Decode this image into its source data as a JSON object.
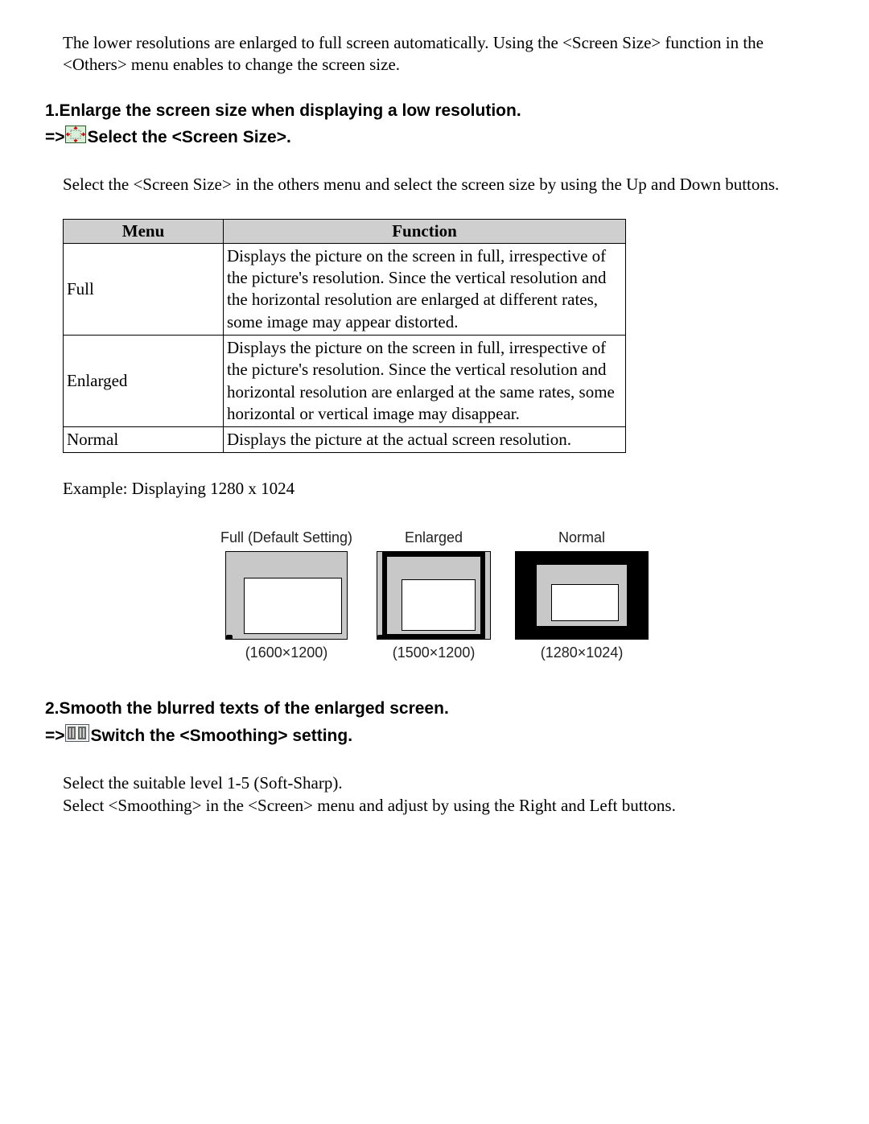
{
  "intro": "The lower resolutions are enlarged to full screen automatically. Using the <Screen Size> function in the <Others> menu enables to change the screen size.",
  "section1": {
    "title": "1.Enlarge the screen size when displaying a low resolution.",
    "arrow": "=>",
    "subtitle": "Select the <Screen Size>.",
    "body": "Select the <Screen Size> in the others menu and select the screen size by using the Up and Down buttons."
  },
  "table": {
    "header_menu": "Menu",
    "header_function": "Function",
    "rows": [
      {
        "menu": "Full",
        "function": "Displays the picture on the screen in full, irrespective of the picture's resolution. Since the vertical resolution and the horizontal resolution are enlarged at different rates, some image may appear distorted."
      },
      {
        "menu": "Enlarged",
        "function": "Displays the picture on the screen in full, irrespective of the picture's resolution. Since the vertical resolution and horizontal resolution are enlarged at the same rates, some horizontal or vertical image may disappear."
      },
      {
        "menu": "Normal",
        "function": "Displays the picture at the actual screen resolution."
      }
    ]
  },
  "example_label": "Example: Displaying 1280 x 1024",
  "diagrams": {
    "full_title": "Full (Default Setting)",
    "full_caption": "(1600×1200)",
    "enlarged_title": "Enlarged",
    "enlarged_caption": "(1500×1200)",
    "normal_title": "Normal",
    "normal_caption": "(1280×1024)"
  },
  "section2": {
    "title": "2.Smooth the blurred texts of the enlarged screen.",
    "arrow": "=>",
    "subtitle": "Switch the <Smoothing> setting.",
    "body1": "Select the suitable level 1-5 (Soft-Sharp).",
    "body2": "Select <Smoothing> in the <Screen> menu and adjust by using the Right and Left buttons."
  }
}
